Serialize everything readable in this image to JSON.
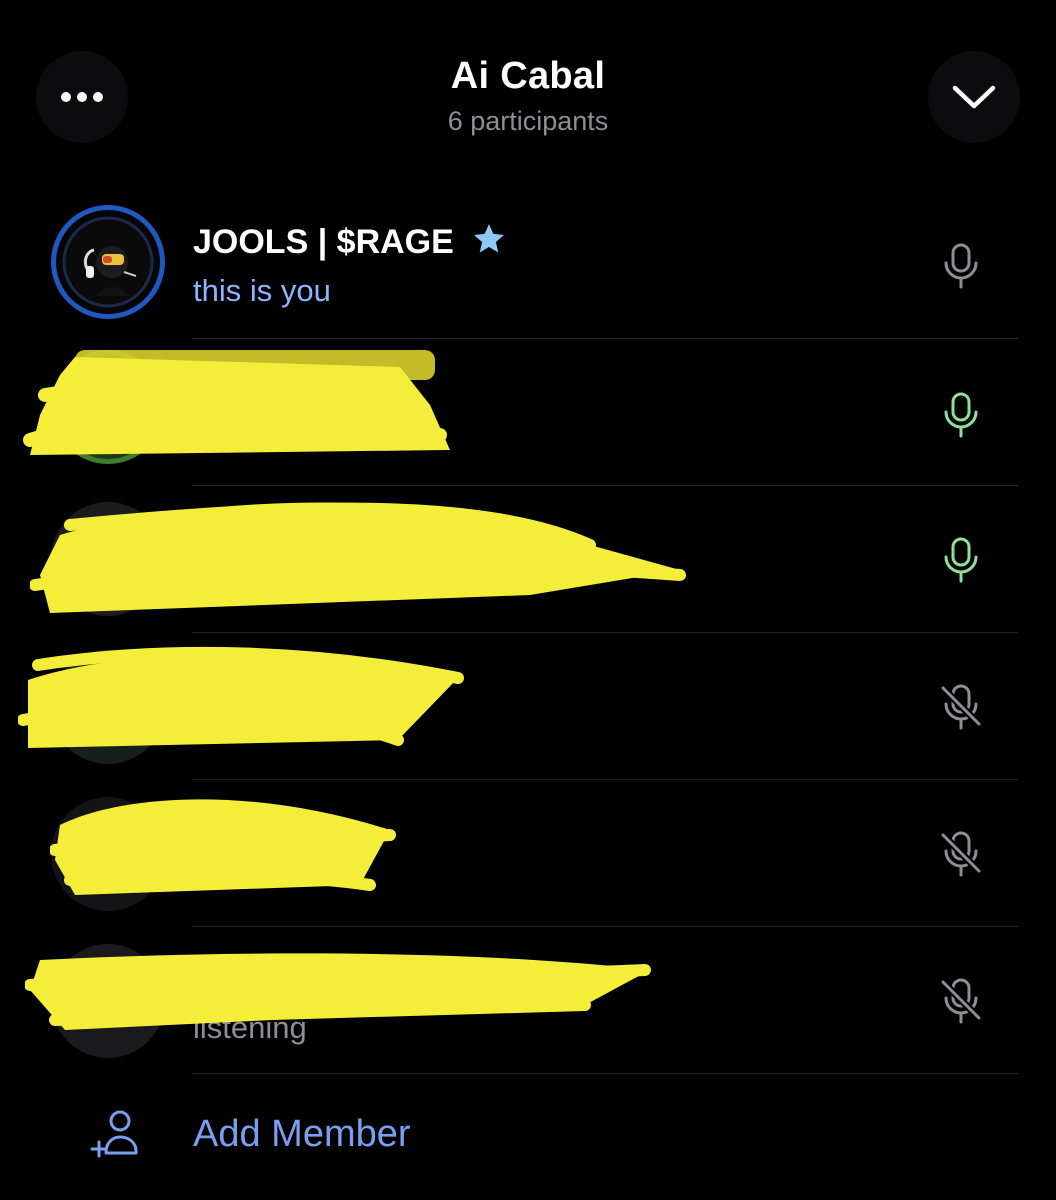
{
  "header": {
    "title": "Ai Cabal",
    "subtitle": "6 participants",
    "more_icon": "ellipsis-icon",
    "close_icon": "chevron-down-icon"
  },
  "participants": [
    {
      "name": "JOOLS | $RAGE",
      "badge": "star",
      "status": "this is you",
      "mic": "mic-icon",
      "mic_state": "idle",
      "redacted": false
    },
    {
      "name": "",
      "status": "",
      "mic": "mic-icon",
      "mic_state": "speaking",
      "redacted": true
    },
    {
      "name": "",
      "status": "",
      "mic": "mic-icon",
      "mic_state": "speaking",
      "redacted": true
    },
    {
      "name": "",
      "status": "",
      "mic": "mic-off-icon",
      "mic_state": "muted",
      "redacted": true
    },
    {
      "name": "",
      "status": "",
      "mic": "mic-off-icon",
      "mic_state": "muted",
      "redacted": true
    },
    {
      "name": "",
      "status": "listening",
      "mic": "mic-off-icon",
      "mic_state": "muted",
      "redacted": true
    }
  ],
  "add_member": {
    "label": "Add Member",
    "icon": "add-person-icon"
  },
  "colors": {
    "background": "#000000",
    "accent": "#7b9ff0",
    "self_status": "#8eb3ff",
    "speaking": "#8fe09a",
    "muted_icon": "#8e8e93",
    "star": "#8ec8f5",
    "redaction": "#f4ee3a"
  }
}
